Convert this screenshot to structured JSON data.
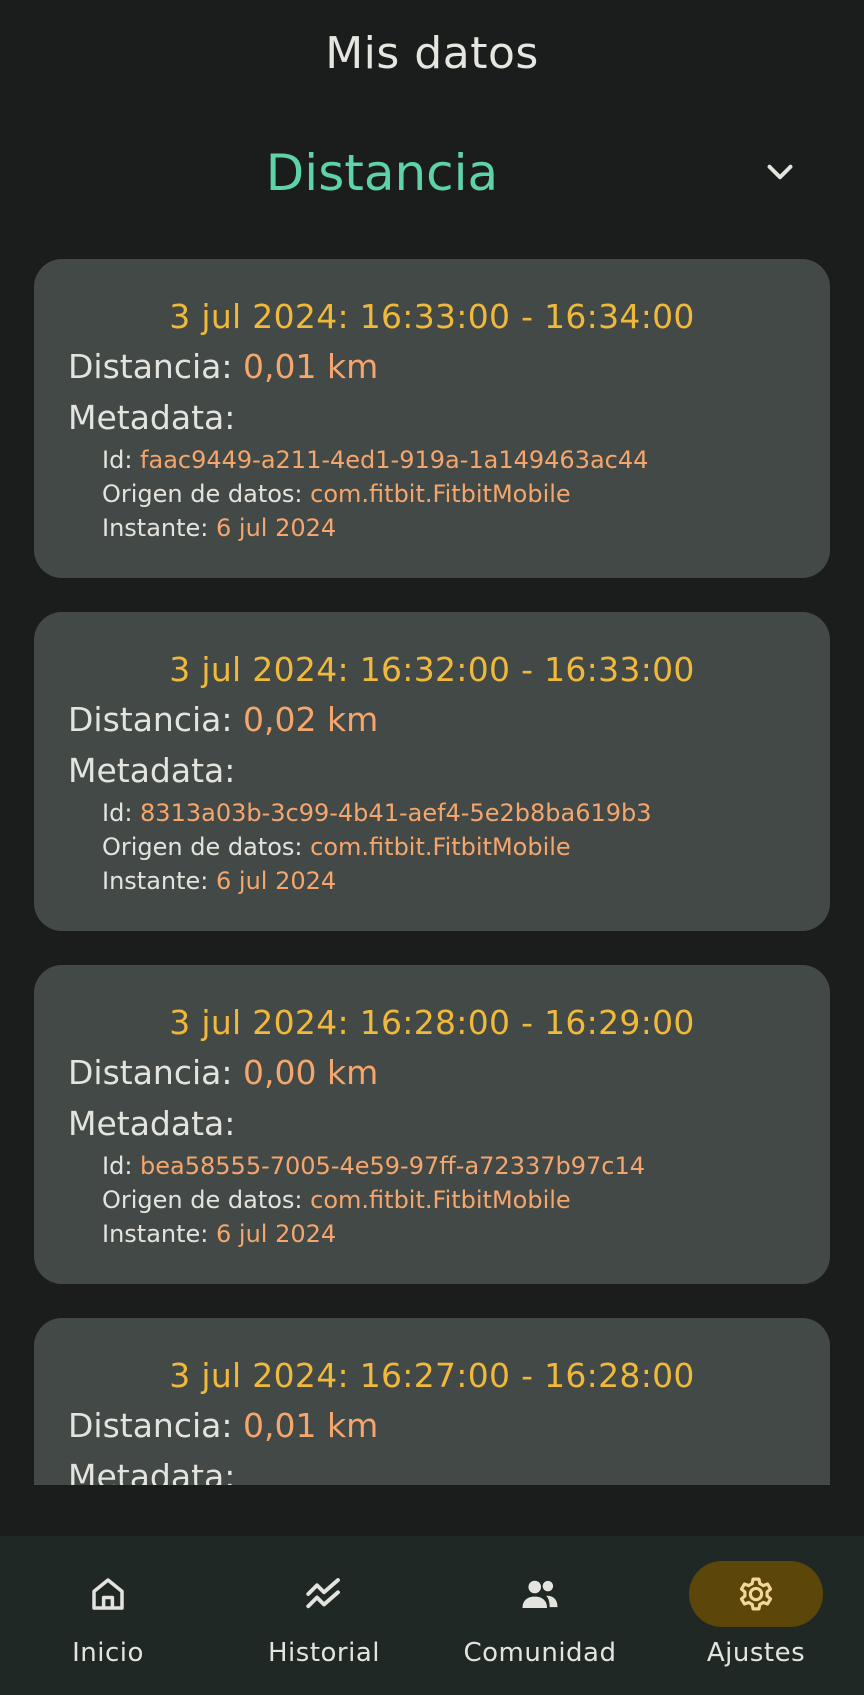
{
  "header": {
    "title": "Mis datos"
  },
  "selector": {
    "value": "Distancia"
  },
  "labels": {
    "distance": "Distancia: ",
    "metadata": "Metadata:",
    "id": "Id: ",
    "origin": "Origen de datos: ",
    "instant": "Instante: "
  },
  "records": [
    {
      "time": "3 jul 2024: 16:33:00 - 16:34:00",
      "distance": "0,01 km",
      "id": "faac9449-a211-4ed1-919a-1a149463ac44",
      "origin": "com.fitbit.FitbitMobile",
      "instant": "6 jul 2024"
    },
    {
      "time": "3 jul 2024: 16:32:00 - 16:33:00",
      "distance": "0,02 km",
      "id": "8313a03b-3c99-4b41-aef4-5e2b8ba619b3",
      "origin": "com.fitbit.FitbitMobile",
      "instant": "6 jul 2024"
    },
    {
      "time": "3 jul 2024: 16:28:00 - 16:29:00",
      "distance": "0,00 km",
      "id": "bea58555-7005-4e59-97ff-a72337b97c14",
      "origin": "com.fitbit.FitbitMobile",
      "instant": "6 jul 2024"
    },
    {
      "time": "3 jul 2024: 16:27:00 - 16:28:00",
      "distance": "0,01 km"
    }
  ],
  "nav": {
    "items": [
      {
        "label": "Inicio",
        "icon": "home-icon"
      },
      {
        "label": "Historial",
        "icon": "history-chart-icon"
      },
      {
        "label": "Comunidad",
        "icon": "community-icon"
      },
      {
        "label": "Ajustes",
        "icon": "gear-icon",
        "active": true
      }
    ]
  },
  "colors": {
    "background": "#1b1c1c",
    "card": "#434946",
    "accent_green": "#5fd3a8",
    "time_yellow": "#f0b93b",
    "value_orange": "#f5a66d",
    "nav_bg": "#202826",
    "nav_active": "#5c4609"
  }
}
